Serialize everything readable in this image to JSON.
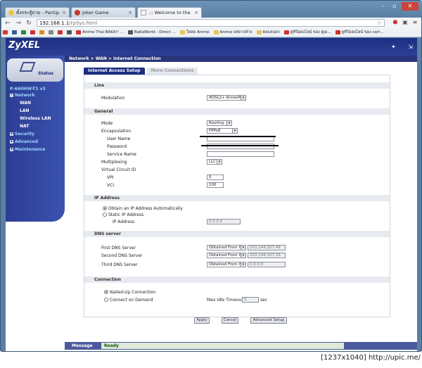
{
  "browser": {
    "tabs": [
      {
        "label": "ตั้งกระทู้ถาม - Pantip"
      },
      {
        "label": "Joker Game"
      },
      {
        "label": ".:: Welcome to the Web-B"
      }
    ],
    "url_host": "192.168.1.1",
    "url_path": "/rpSys.html",
    "bookmarks": [
      {
        "label": "Anime Thai BAKA!! ..."
      },
      {
        "label": "BaKaWorld - Direct ..."
      },
      {
        "label": "โหลด Anime"
      },
      {
        "label": "Anime บทจากคำถ"
      },
      {
        "label": "ตลแจนจก"
      },
      {
        "label": "ดูทีวีออนไลน์ ของ ดูเด..."
      },
      {
        "label": "ดูทีวีออนไลน์ ของ cart..."
      }
    ]
  },
  "router": {
    "logo": "ZyXEL",
    "breadcrumb": "Network > WAN > Internet Connection",
    "status_label": "Status",
    "model": "P-660HW-T1 v3",
    "menu": [
      {
        "label": "Network",
        "expand": "-"
      },
      {
        "label": "WAN",
        "sub": true
      },
      {
        "label": "LAN",
        "sub": true
      },
      {
        "label": "Wireless LAN",
        "sub": true
      },
      {
        "label": "NAT",
        "sub": true
      },
      {
        "label": "Security",
        "expand": "+"
      },
      {
        "label": "Advanced",
        "expand": "+"
      },
      {
        "label": "Maintenance",
        "expand": "+"
      }
    ],
    "tab_active": "Internet Access Setup",
    "tab_inactive": "More Connections",
    "sections": {
      "line": "Line",
      "general": "General",
      "ip": "IP Address",
      "dns": "DNS server",
      "connection": "Connection"
    },
    "labels": {
      "modulation": "Modulation",
      "mode": "Mode",
      "encapsulation": "Encapsulation",
      "user_name": "User Name",
      "password": "Password",
      "service_name": "Service Name",
      "multiplexing": "Multiplexing",
      "virtual_circuit": "Virtual Circuit ID",
      "vpi": "VPI",
      "vci": "VCI",
      "obtain_auto": "Obtain an IP Address Automatically",
      "static_ip": "Static IP Address",
      "ip_address": "IP Address",
      "first_dns": "First DNS Server",
      "second_dns": "Second DNS Server",
      "third_dns": "Third DNS Server",
      "nailed_up": "Nailed-Up Connection",
      "connect_demand": "Connect on Demand",
      "max_idle": "Max Idle Timeout",
      "sec": "sec"
    },
    "values": {
      "modulation": "ADSL2+ AnnexM",
      "mode": "Routing",
      "encapsulation": "PPPoE",
      "multiplexing": "LLC",
      "vpi": "0",
      "vci": "100",
      "static_ip": "0.0.0.0",
      "dns1_mode": "Obtained From ISP",
      "dns1": "203.144.207.49",
      "dns2_mode": "Obtained From ISP",
      "dns2": "203.144.207.29",
      "dns3_mode": "Obtained From ISP",
      "dns3": "0.0.0.0",
      "idle_timeout": "0"
    },
    "buttons": {
      "apply": "Apply",
      "cancel": "Cancel",
      "advanced": "Advanced Setup"
    },
    "message_label": "Message",
    "message_value": "Ready"
  },
  "caption": "[1237x1040] http://upic.me/"
}
